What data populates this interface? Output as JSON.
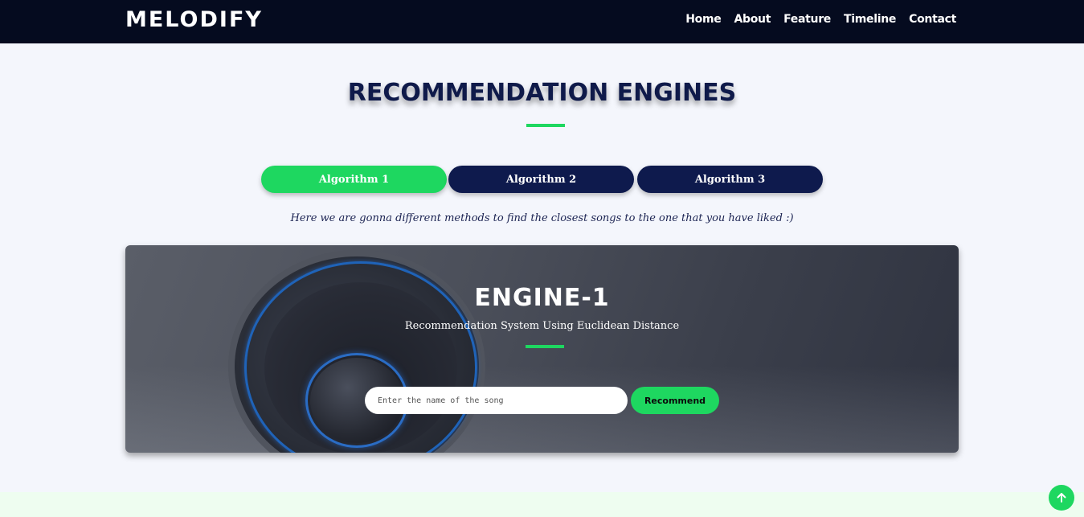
{
  "navbar": {
    "brand": "MELODIFY",
    "links": [
      "Home",
      "About",
      "Feature",
      "Timeline",
      "Contact"
    ]
  },
  "section": {
    "title": "RECOMMENDATION ENGINES",
    "tabs": [
      "Algorithm 1",
      "Algorithm 2",
      "Algorithm 3"
    ],
    "active_tab": "Algorithm 1",
    "subtitle": "Here we are gonna different methods to find the closest songs to the one that you have liked :)"
  },
  "engine": {
    "title": "ENGINE-1",
    "description": "Recommendation System Using Euclidean Distance",
    "input_placeholder": "Enter the name of the song",
    "input_value": "",
    "button_label": "Recommend"
  },
  "icons": {
    "scroll_top": "arrow-up-icon",
    "card_image": "speaker-image"
  },
  "colors": {
    "accent": "#1ed760",
    "navy": "#0e1a4d",
    "navbar_bg": "#050b1f",
    "page_bg": "#f4f6fc"
  }
}
